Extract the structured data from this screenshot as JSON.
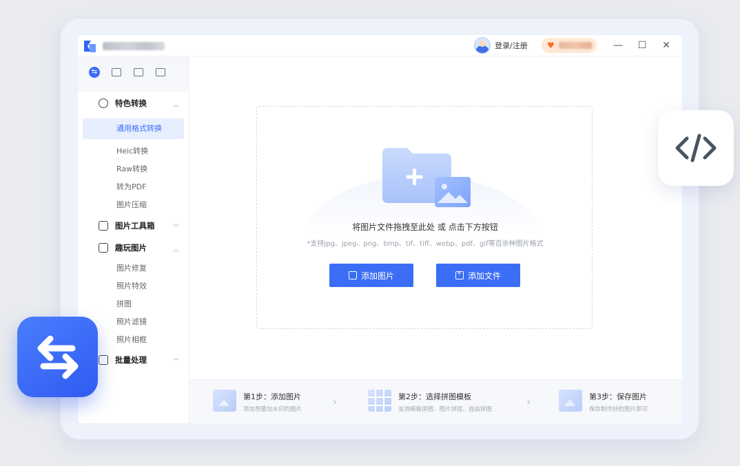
{
  "titlebar": {
    "login_label": "登录/注册",
    "minimize": "—",
    "maximize": "☐",
    "close": "✕"
  },
  "sidebar": {
    "tabs": [
      {
        "icon": "convert-icon",
        "active": true
      },
      {
        "icon": "toolbox-icon",
        "active": false
      },
      {
        "icon": "image-icon",
        "active": false
      },
      {
        "icon": "batch-icon",
        "active": false
      }
    ],
    "groups": {
      "special_convert": "特色转换",
      "image_toolbox": "图片工具箱",
      "fun_image": "趣玩图片",
      "batch": "批量处理"
    },
    "items": {
      "general_format": "通用格式转换",
      "heic": "Heic转换",
      "raw": "Raw转换",
      "to_pdf": "转为PDF",
      "compress": "图片压缩",
      "repair": "图片修复",
      "effects": "照片特效",
      "collage": "拼图",
      "filters": "照片滤镜",
      "frames": "照片相框"
    }
  },
  "main": {
    "drop_title": "将图片文件拖拽至此处 或 点击下方按钮",
    "drop_hint": "*支持jpg、jpeg、png、bmp、tif、tiff、webp、pdf、gif等百余种图片格式",
    "add_image_button": "添加图片",
    "add_file_button": "添加文件"
  },
  "steps": [
    {
      "title": "第1步：添加图片",
      "desc": "添加想要加水印的图片"
    },
    {
      "title": "第2步：选择拼图模板",
      "desc": "支持模板拼图、图片拼接、自由拼图"
    },
    {
      "title": "第3步：保存图片",
      "desc": "保存制作好的图片即可"
    }
  ],
  "colors": {
    "accent": "#3b6ef5",
    "vip_bg": "#ffe8d6"
  }
}
